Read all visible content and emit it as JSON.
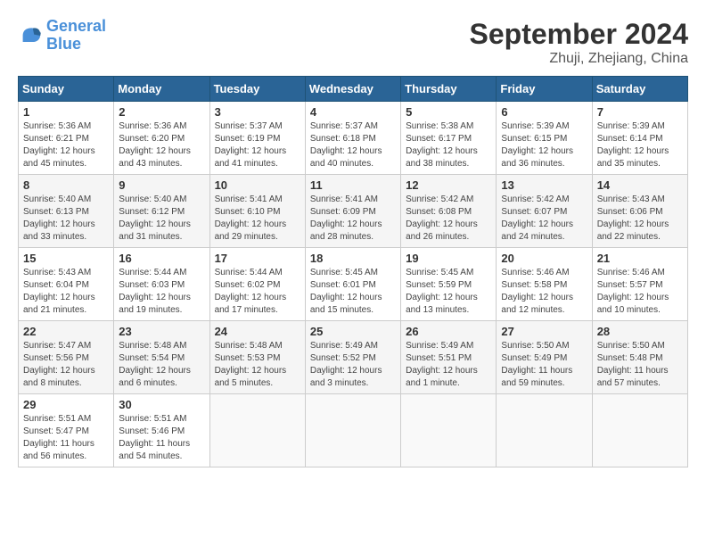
{
  "logo": {
    "line1": "General",
    "line2": "Blue"
  },
  "title": "September 2024",
  "location": "Zhuji, Zhejiang, China",
  "weekdays": [
    "Sunday",
    "Monday",
    "Tuesday",
    "Wednesday",
    "Thursday",
    "Friday",
    "Saturday"
  ],
  "weeks": [
    [
      {
        "day": "1",
        "info": "Sunrise: 5:36 AM\nSunset: 6:21 PM\nDaylight: 12 hours\nand 45 minutes."
      },
      {
        "day": "2",
        "info": "Sunrise: 5:36 AM\nSunset: 6:20 PM\nDaylight: 12 hours\nand 43 minutes."
      },
      {
        "day": "3",
        "info": "Sunrise: 5:37 AM\nSunset: 6:19 PM\nDaylight: 12 hours\nand 41 minutes."
      },
      {
        "day": "4",
        "info": "Sunrise: 5:37 AM\nSunset: 6:18 PM\nDaylight: 12 hours\nand 40 minutes."
      },
      {
        "day": "5",
        "info": "Sunrise: 5:38 AM\nSunset: 6:17 PM\nDaylight: 12 hours\nand 38 minutes."
      },
      {
        "day": "6",
        "info": "Sunrise: 5:39 AM\nSunset: 6:15 PM\nDaylight: 12 hours\nand 36 minutes."
      },
      {
        "day": "7",
        "info": "Sunrise: 5:39 AM\nSunset: 6:14 PM\nDaylight: 12 hours\nand 35 minutes."
      }
    ],
    [
      {
        "day": "8",
        "info": "Sunrise: 5:40 AM\nSunset: 6:13 PM\nDaylight: 12 hours\nand 33 minutes."
      },
      {
        "day": "9",
        "info": "Sunrise: 5:40 AM\nSunset: 6:12 PM\nDaylight: 12 hours\nand 31 minutes."
      },
      {
        "day": "10",
        "info": "Sunrise: 5:41 AM\nSunset: 6:10 PM\nDaylight: 12 hours\nand 29 minutes."
      },
      {
        "day": "11",
        "info": "Sunrise: 5:41 AM\nSunset: 6:09 PM\nDaylight: 12 hours\nand 28 minutes."
      },
      {
        "day": "12",
        "info": "Sunrise: 5:42 AM\nSunset: 6:08 PM\nDaylight: 12 hours\nand 26 minutes."
      },
      {
        "day": "13",
        "info": "Sunrise: 5:42 AM\nSunset: 6:07 PM\nDaylight: 12 hours\nand 24 minutes."
      },
      {
        "day": "14",
        "info": "Sunrise: 5:43 AM\nSunset: 6:06 PM\nDaylight: 12 hours\nand 22 minutes."
      }
    ],
    [
      {
        "day": "15",
        "info": "Sunrise: 5:43 AM\nSunset: 6:04 PM\nDaylight: 12 hours\nand 21 minutes."
      },
      {
        "day": "16",
        "info": "Sunrise: 5:44 AM\nSunset: 6:03 PM\nDaylight: 12 hours\nand 19 minutes."
      },
      {
        "day": "17",
        "info": "Sunrise: 5:44 AM\nSunset: 6:02 PM\nDaylight: 12 hours\nand 17 minutes."
      },
      {
        "day": "18",
        "info": "Sunrise: 5:45 AM\nSunset: 6:01 PM\nDaylight: 12 hours\nand 15 minutes."
      },
      {
        "day": "19",
        "info": "Sunrise: 5:45 AM\nSunset: 5:59 PM\nDaylight: 12 hours\nand 13 minutes."
      },
      {
        "day": "20",
        "info": "Sunrise: 5:46 AM\nSunset: 5:58 PM\nDaylight: 12 hours\nand 12 minutes."
      },
      {
        "day": "21",
        "info": "Sunrise: 5:46 AM\nSunset: 5:57 PM\nDaylight: 12 hours\nand 10 minutes."
      }
    ],
    [
      {
        "day": "22",
        "info": "Sunrise: 5:47 AM\nSunset: 5:56 PM\nDaylight: 12 hours\nand 8 minutes."
      },
      {
        "day": "23",
        "info": "Sunrise: 5:48 AM\nSunset: 5:54 PM\nDaylight: 12 hours\nand 6 minutes."
      },
      {
        "day": "24",
        "info": "Sunrise: 5:48 AM\nSunset: 5:53 PM\nDaylight: 12 hours\nand 5 minutes."
      },
      {
        "day": "25",
        "info": "Sunrise: 5:49 AM\nSunset: 5:52 PM\nDaylight: 12 hours\nand 3 minutes."
      },
      {
        "day": "26",
        "info": "Sunrise: 5:49 AM\nSunset: 5:51 PM\nDaylight: 12 hours\nand 1 minute."
      },
      {
        "day": "27",
        "info": "Sunrise: 5:50 AM\nSunset: 5:49 PM\nDaylight: 11 hours\nand 59 minutes."
      },
      {
        "day": "28",
        "info": "Sunrise: 5:50 AM\nSunset: 5:48 PM\nDaylight: 11 hours\nand 57 minutes."
      }
    ],
    [
      {
        "day": "29",
        "info": "Sunrise: 5:51 AM\nSunset: 5:47 PM\nDaylight: 11 hours\nand 56 minutes."
      },
      {
        "day": "30",
        "info": "Sunrise: 5:51 AM\nSunset: 5:46 PM\nDaylight: 11 hours\nand 54 minutes."
      },
      {
        "day": "",
        "info": ""
      },
      {
        "day": "",
        "info": ""
      },
      {
        "day": "",
        "info": ""
      },
      {
        "day": "",
        "info": ""
      },
      {
        "day": "",
        "info": ""
      }
    ]
  ]
}
